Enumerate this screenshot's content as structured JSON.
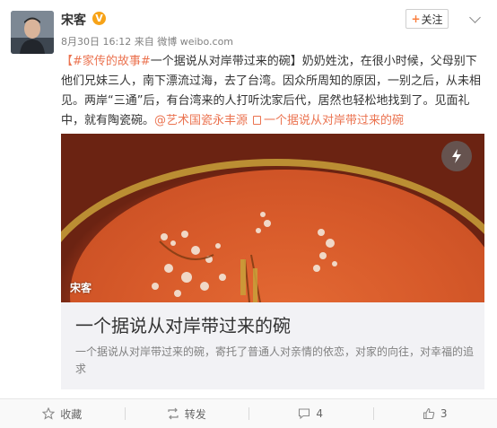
{
  "user": {
    "name": "宋客",
    "verified_badge": "V",
    "time": "8月30日 16:12",
    "source": "来自 微博 weibo.com"
  },
  "follow": {
    "label": "关注",
    "plus": "+"
  },
  "post": {
    "topic": "【#家传的故事#",
    "text": "一个据说从对岸带过来的碗】奶奶姓沈，在很小时候，父母别下他们兄妹三人，南下漂流过海，去了台湾。因众所周知的原因，一别之后，从未相见。两岸“三通”后，有台湾来的人打听沈家后代，居然也轻松地找到了。见面礼中，就有陶瓷碗。",
    "mention": "@艺术国瓷永丰源",
    "link_text": "一个据说从对岸带过来的碗"
  },
  "card": {
    "watermark": "宋客",
    "title": "一个据说从对岸带过来的碗",
    "description": "一个据说从对岸带过来的碗，寄托了普通人对亲情的依恋，对家的向往，对幸福的追求"
  },
  "actions": {
    "favorite": "收藏",
    "repost": "转发",
    "comment_count": "4",
    "like_count": "3"
  },
  "colors": {
    "accent": "#eb7350",
    "badge": "#f7a318",
    "bowl": "#d75a2a"
  }
}
